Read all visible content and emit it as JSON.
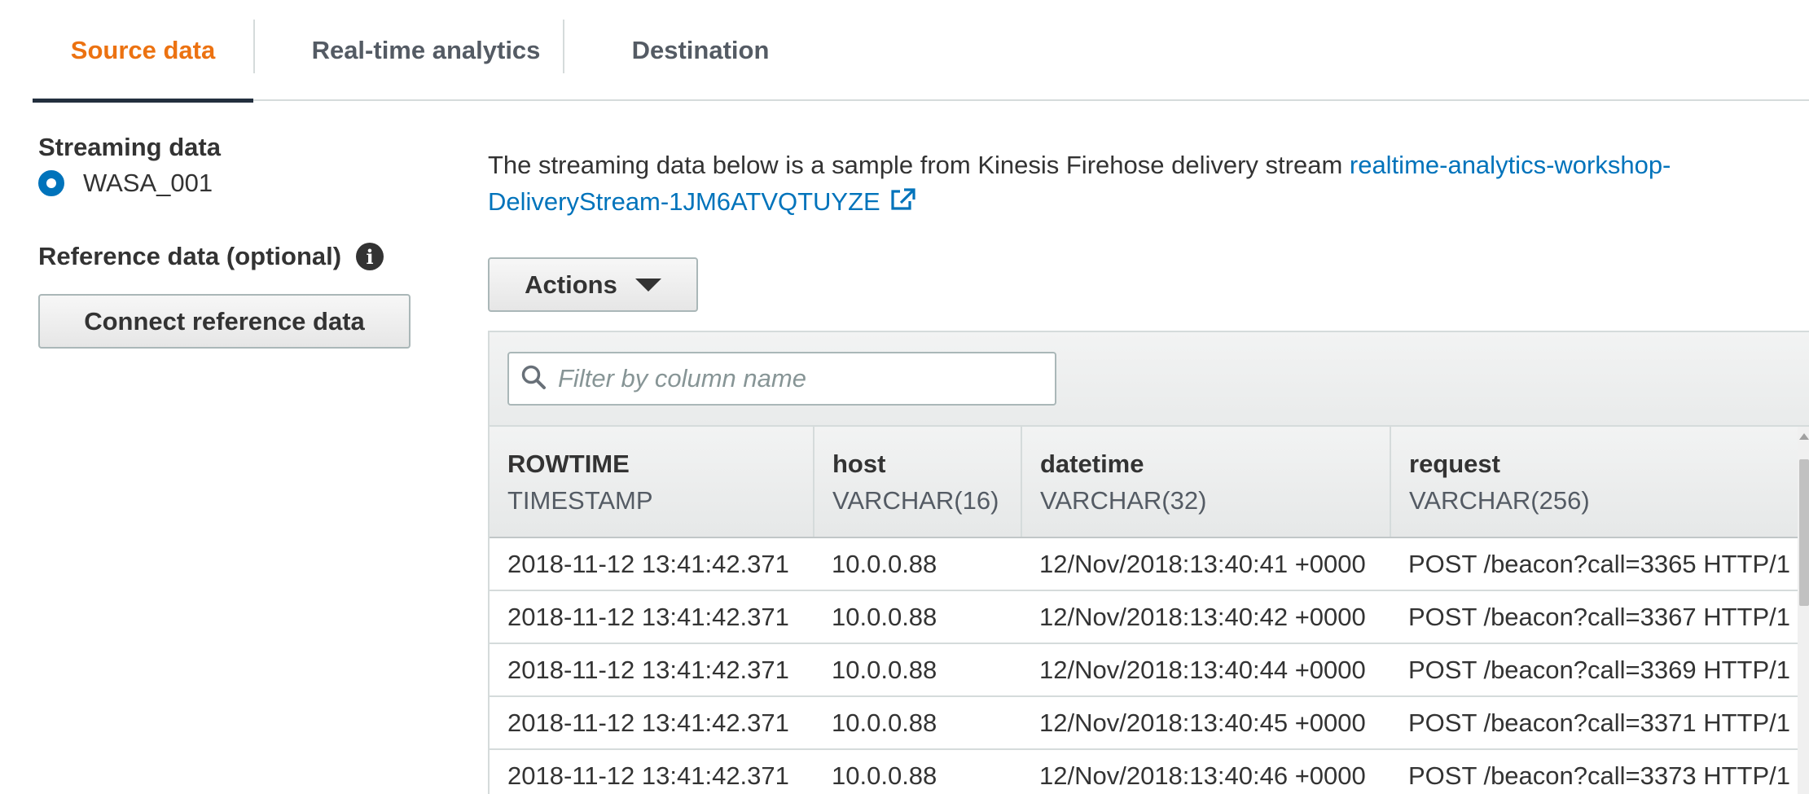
{
  "tabs": [
    {
      "label": "Source data",
      "active": true
    },
    {
      "label": "Real-time analytics",
      "active": false
    },
    {
      "label": "Destination",
      "active": false
    }
  ],
  "sidebar": {
    "streaming_title": "Streaming data",
    "streaming_option": "WASA_001",
    "reference_title": "Reference data (optional)",
    "connect_button": "Connect reference data"
  },
  "main": {
    "description_prefix": "The streaming data below is a sample from Kinesis Firehose delivery stream ",
    "stream_link_line1": "realtime-analytics-workshop-",
    "stream_link_line2": "DeliveryStream-1JM6ATVQTUYZE",
    "actions_button": "Actions",
    "filter_placeholder": "Filter by column name"
  },
  "table": {
    "columns": [
      {
        "name": "ROWTIME",
        "type": "TIMESTAMP"
      },
      {
        "name": "host",
        "type": "VARCHAR(16)"
      },
      {
        "name": "datetime",
        "type": "VARCHAR(32)"
      },
      {
        "name": "request",
        "type": "VARCHAR(256)"
      }
    ],
    "rows": [
      [
        "2018-11-12 13:41:42.371",
        "10.0.0.88",
        "12/Nov/2018:13:40:41 +0000",
        "POST /beacon?call=3365 HTTP/1"
      ],
      [
        "2018-11-12 13:41:42.371",
        "10.0.0.88",
        "12/Nov/2018:13:40:42 +0000",
        "POST /beacon?call=3367 HTTP/1"
      ],
      [
        "2018-11-12 13:41:42.371",
        "10.0.0.88",
        "12/Nov/2018:13:40:44 +0000",
        "POST /beacon?call=3369 HTTP/1"
      ],
      [
        "2018-11-12 13:41:42.371",
        "10.0.0.88",
        "12/Nov/2018:13:40:45 +0000",
        "POST /beacon?call=3371 HTTP/1"
      ],
      [
        "2018-11-12 13:41:42.371",
        "10.0.0.88",
        "12/Nov/2018:13:40:46 +0000",
        "POST /beacon?call=3373 HTTP/1"
      ]
    ]
  },
  "colors": {
    "active_tab": "#ec7211",
    "link": "#0073bb"
  }
}
